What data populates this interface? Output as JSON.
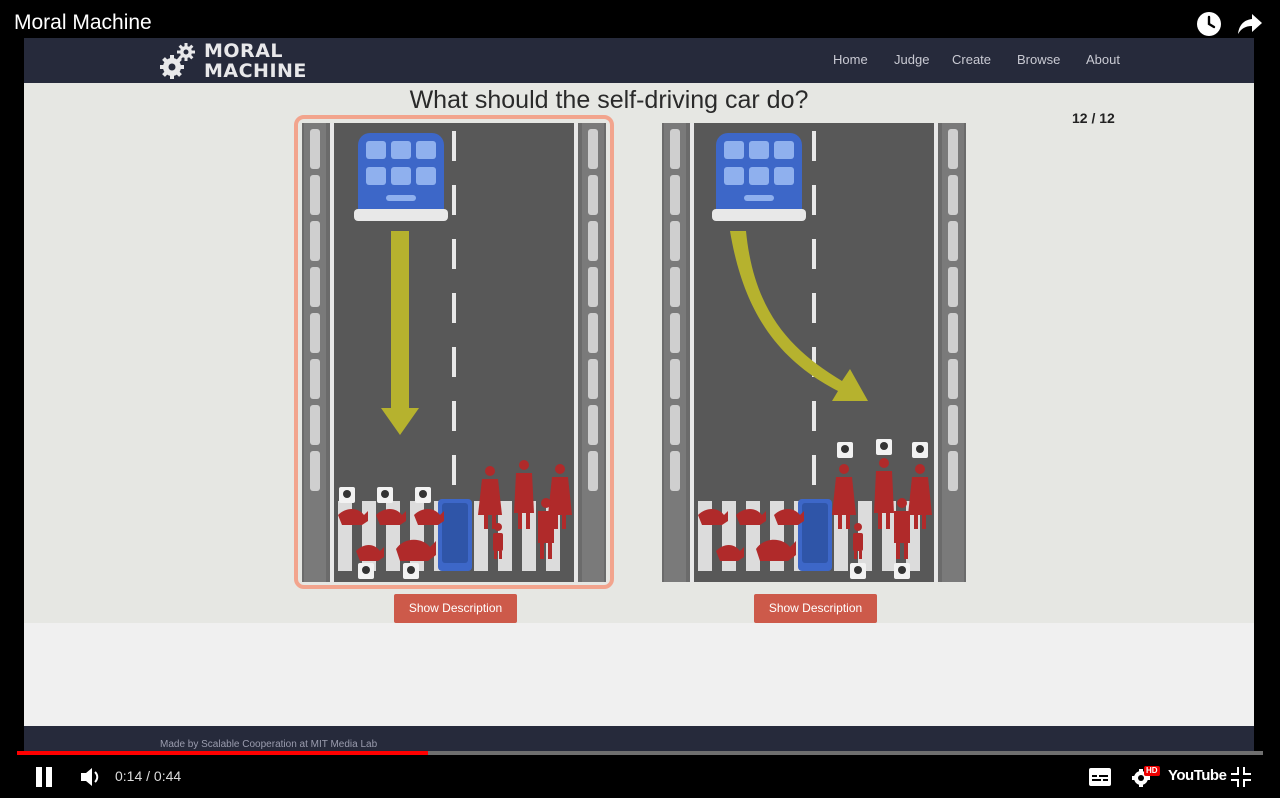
{
  "video": {
    "title": "Moral Machine",
    "current_time": "0:14",
    "duration": "0:44",
    "progress": 0.33,
    "time_separator": " / ",
    "youtube_label": "YouTube",
    "hd_badge": "HD"
  },
  "site": {
    "logo_line1": "MORAL",
    "logo_line2": "MACHINE",
    "nav": [
      "Home",
      "Judge",
      "Create",
      "Browse",
      "About"
    ],
    "question": "What should the self-driving car do?",
    "counter": "12 / 12",
    "footer_text": "Made by Scalable Cooperation at MIT Media Lab",
    "scenarios": [
      {
        "button_label": "Show Description",
        "selected": true,
        "arrow": "straight"
      },
      {
        "button_label": "Show Description",
        "selected": false,
        "arrow": "swerve"
      }
    ]
  },
  "icons": {
    "watch_later": "clock-icon",
    "share": "share-arrow-icon",
    "pause": "pause-icon",
    "volume": "volume-icon",
    "captions": "captions-icon",
    "settings": "gear-icon",
    "fullscreen": "exit-fullscreen-icon"
  },
  "colors": {
    "nav_bg": "#262a3b",
    "page_bg": "#e6e7e3",
    "button": "#cd5a4a",
    "selection_border": "#f2a48d",
    "road": "#585858",
    "arrow": "#b6b22e",
    "figures": "#b02a2a",
    "car": "#3d67c8",
    "progress": "#ff0000"
  }
}
